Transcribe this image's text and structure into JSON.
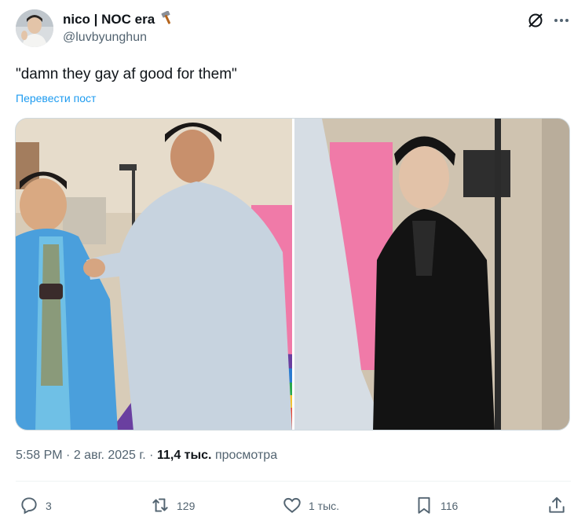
{
  "tweet": {
    "author_name": "nico | NOC era",
    "author_handle": "@luvbyunghun",
    "text": "\"damn they gay af good for them\"",
    "translate_label": "Перевести пост",
    "time": "5:58 PM",
    "date": "2 авг. 2025 г.",
    "views_count": "11,4 тыс.",
    "views_label": "просмотра"
  },
  "actions": {
    "replies": "3",
    "reposts": "129",
    "likes": "1 тыс.",
    "bookmarks": "116"
  },
  "icons": [
    "hammer-icon",
    "grok-icon",
    "more-icon",
    "reply-icon",
    "repost-icon",
    "like-icon",
    "bookmark-icon",
    "share-icon"
  ],
  "colors": {
    "link": "#1d9bf0",
    "muted": "#536471",
    "text": "#0f1419"
  }
}
